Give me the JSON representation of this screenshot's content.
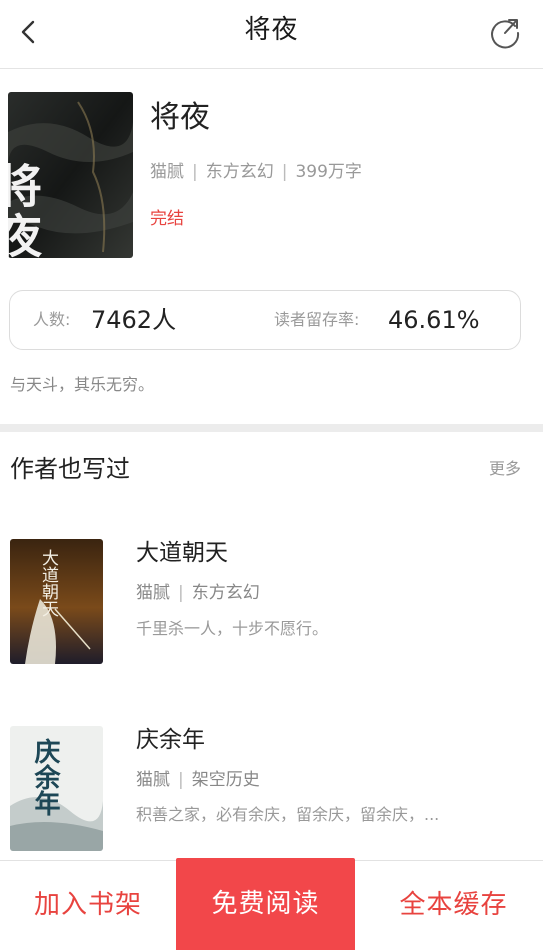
{
  "header": {
    "title": "将夜",
    "back_icon": "chevron-left-icon",
    "share_icon": "share-circle-icon"
  },
  "book": {
    "cover_art_text": "将夜",
    "title": "将夜",
    "author": "猫腻",
    "category": "东方玄幻",
    "word_count": "399万字",
    "status": "完结"
  },
  "stats": {
    "readers_label": "人数:",
    "readers_value": "7462人",
    "retention_label": "读者留存率:",
    "retention_value": "46.61%"
  },
  "tagline": "与天斗，其乐无穷。",
  "author_works": {
    "section_title": "作者也写过",
    "more_label": "更多",
    "books": [
      {
        "title": "大道朝天",
        "author": "猫腻",
        "category": "东方玄幻",
        "description": "千里杀一人，十步不愿行。",
        "cover_art_text": "大道朝天"
      },
      {
        "title": "庆余年",
        "author": "猫腻",
        "category": "架空历史",
        "description": "积善之家，必有余庆，留余庆，留余庆，...",
        "cover_art_text": "庆余年"
      }
    ]
  },
  "bottom_bar": {
    "add_shelf_label": "加入书架",
    "read_free_label": "免费阅读",
    "cache_all_label": "全本缓存"
  },
  "colors": {
    "accent": "#e8433f",
    "primary_button": "#f2474a"
  }
}
